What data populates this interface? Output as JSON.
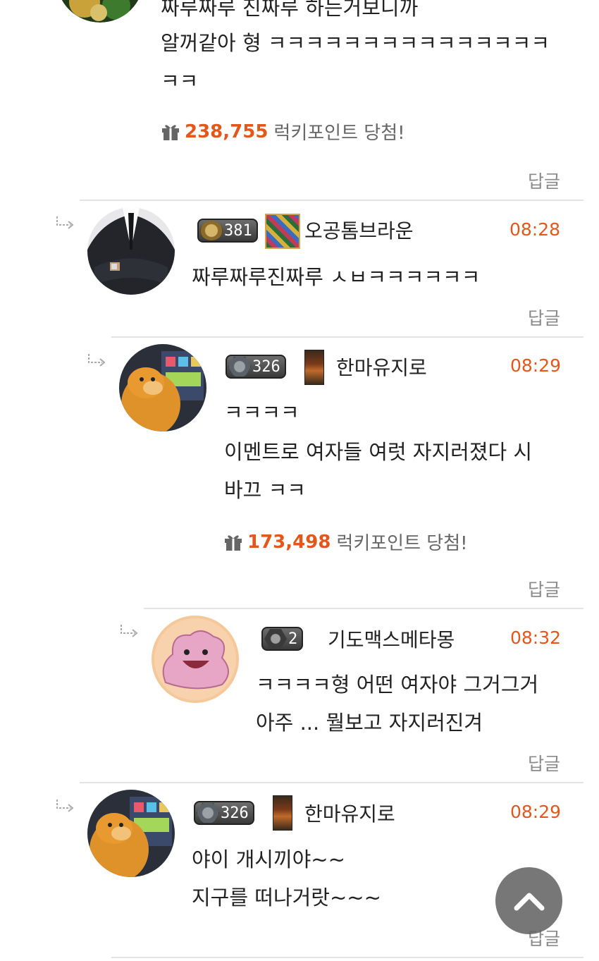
{
  "colors": {
    "accent": "#e4571b",
    "reply": "#8a8a8a",
    "divider": "#e4e4e4"
  },
  "top_comment": {
    "lines": [
      "짜루짜루 진짜루 하는거보니까",
      "알꺼같아 형 ㅋㅋㅋㅋㅋㅋㅋㅋㅋㅋㅋㅋㅋㅋㅋ",
      "ㅋㅋ"
    ],
    "lucky_points": "238,755",
    "lucky_label": "럭키포인트 당첨!",
    "reply_label": "답글"
  },
  "comments": [
    {
      "level": "381",
      "username": "오공톰브라운",
      "time": "08:28",
      "lines": [
        "짜루짜루진짜루 ㅅㅂㅋㅋㅋㅋㅋㅋ"
      ],
      "reply_label": "답글"
    },
    {
      "level": "326",
      "username": "한마유지로",
      "time": "08:29",
      "lines": [
        "ㅋㅋㅋㅋ",
        "이멘트로  여자들 여럿 자지러졌다 시",
        "바끄 ㅋㅋ"
      ],
      "lucky_points": "173,498",
      "lucky_label": "럭키포인트 당첨!",
      "reply_label": "답글"
    },
    {
      "level": "2",
      "username": "기도맥스메타몽",
      "time": "08:32",
      "lines": [
        "ㅋㅋㅋㅋ형 어떤 여자야 그거그거",
        "아주 ... 뭘보고 자지러진겨"
      ],
      "reply_label": "답글"
    },
    {
      "level": "326",
      "username": "한마유지로",
      "time": "08:29",
      "lines": [
        "야이 개시끼야~~",
        "지구를 떠나거랏~~~"
      ],
      "reply_label": "답글"
    }
  ],
  "scroll_top_icon": "chevron-up-icon",
  "reply_arrow_icon": "reply-arrow-icon",
  "gift_icon": "gift-icon"
}
